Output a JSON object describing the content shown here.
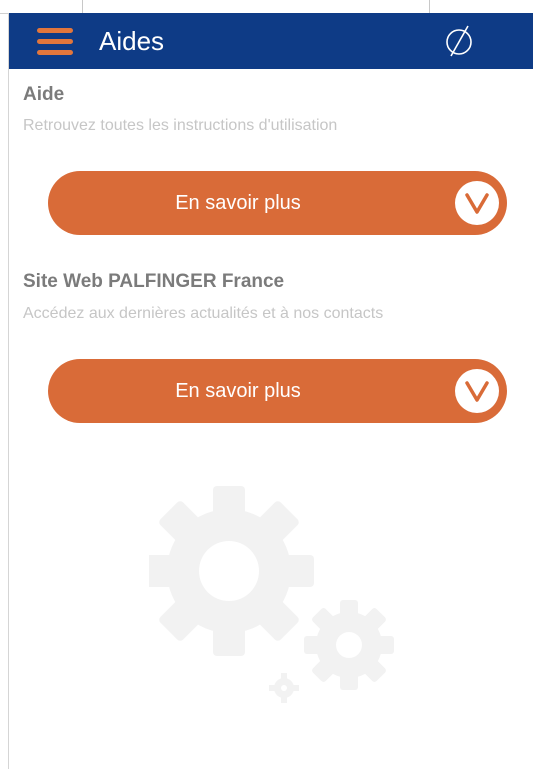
{
  "header": {
    "title": "Aides",
    "menu_icon": "hamburger-menu-icon",
    "right_icon": "empty-set-icon",
    "background_color": "#0e3b86",
    "accent_color": "#e2763c"
  },
  "sections": [
    {
      "title": "Aide",
      "subtitle": "Retrouvez toutes les instructions d'utilisation",
      "button_label": "En savoir plus",
      "button_icon": "chevron-down-circle-icon"
    },
    {
      "title": "Site Web PALFINGER France",
      "subtitle": "Accédez aux dernières actualités et à nos contacts",
      "button_label": "En savoir plus",
      "button_icon": "chevron-down-circle-icon"
    }
  ],
  "colors": {
    "button": "#d96b38",
    "title_text": "#7b7b7b",
    "subtitle_text": "#c6c6c6",
    "watermark": "#f2f2f2"
  },
  "watermark_icon": "gears-icon"
}
